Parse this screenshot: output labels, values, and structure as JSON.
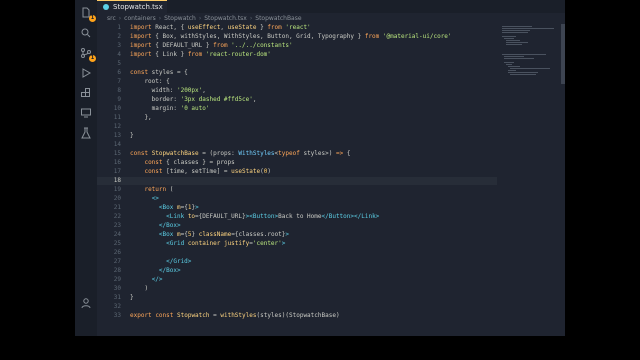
{
  "tab": {
    "label": "Stopwatch.tsx"
  },
  "breadcrumb": [
    "src",
    "containers",
    "Stopwatch",
    "Stopwatch.tsx",
    "StopwatchBase"
  ],
  "editor": {
    "current_line": 18,
    "lines": [
      {
        "n": "1",
        "segs": [
          [
            "k",
            "import"
          ],
          [
            "p",
            " React, { "
          ],
          [
            "f",
            "useEffect"
          ],
          [
            "p",
            ", "
          ],
          [
            "f",
            "useState"
          ],
          [
            "p",
            " } "
          ],
          [
            "k",
            "from"
          ],
          [
            "s",
            " 'react'"
          ]
        ]
      },
      {
        "n": "2",
        "segs": [
          [
            "k",
            "import"
          ],
          [
            "p",
            " { Box, withStyles, WithStyles, Button, Grid, Typography } "
          ],
          [
            "k",
            "from"
          ],
          [
            "s",
            " '@material-ui/core'"
          ]
        ]
      },
      {
        "n": "3",
        "segs": [
          [
            "k",
            "import"
          ],
          [
            "p",
            " { DEFAULT_URL } "
          ],
          [
            "k",
            "from"
          ],
          [
            "s",
            " '../../constants'"
          ]
        ]
      },
      {
        "n": "4",
        "segs": [
          [
            "k",
            "import"
          ],
          [
            "p",
            " { Link } "
          ],
          [
            "k",
            "from"
          ],
          [
            "s",
            " 'react-router-dom'"
          ]
        ]
      },
      {
        "n": "5",
        "segs": []
      },
      {
        "n": "6",
        "segs": [
          [
            "k",
            "const"
          ],
          [
            "p",
            " styles = {"
          ]
        ]
      },
      {
        "n": "7",
        "segs": [
          [
            "p",
            "    root: {"
          ]
        ]
      },
      {
        "n": "8",
        "segs": [
          [
            "p",
            "      width: "
          ],
          [
            "s",
            "'200px'"
          ],
          [
            "p",
            ","
          ]
        ]
      },
      {
        "n": "9",
        "segs": [
          [
            "p",
            "      border: "
          ],
          [
            "s",
            "'3px dashed #ffd5ce'"
          ],
          [
            "p",
            ","
          ]
        ]
      },
      {
        "n": "10",
        "segs": [
          [
            "p",
            "      margin: "
          ],
          [
            "s",
            "'0 auto'"
          ]
        ]
      },
      {
        "n": "11",
        "segs": [
          [
            "p",
            "    },"
          ]
        ]
      },
      {
        "n": "12",
        "segs": []
      },
      {
        "n": "13",
        "segs": [
          [
            "p",
            "}"
          ]
        ]
      },
      {
        "n": "14",
        "segs": []
      },
      {
        "n": "15",
        "segs": [
          [
            "k",
            "const"
          ],
          [
            "p",
            " "
          ],
          [
            "f",
            "StopwatchBase"
          ],
          [
            "p",
            " = (props: "
          ],
          [
            "t",
            "WithStyles"
          ],
          [
            "p",
            "<"
          ],
          [
            "k",
            "typeof"
          ],
          [
            "p",
            " styles>) "
          ],
          [
            "k",
            "=>"
          ],
          [
            "p",
            " {"
          ]
        ]
      },
      {
        "n": "16",
        "segs": [
          [
            "p",
            "    "
          ],
          [
            "k",
            "const"
          ],
          [
            "p",
            " { classes } = props"
          ]
        ]
      },
      {
        "n": "17",
        "segs": [
          [
            "p",
            "    "
          ],
          [
            "k",
            "const"
          ],
          [
            "p",
            " [time, setTime] = "
          ],
          [
            "f",
            "useState"
          ],
          [
            "p",
            "("
          ],
          [
            "n",
            "0"
          ],
          [
            "p",
            ")"
          ]
        ]
      },
      {
        "n": "18",
        "segs": []
      },
      {
        "n": "19",
        "segs": [
          [
            "p",
            "    "
          ],
          [
            "k",
            "return"
          ],
          [
            "p",
            " ("
          ]
        ]
      },
      {
        "n": "20",
        "segs": [
          [
            "p",
            "      "
          ],
          [
            "c",
            "<>"
          ]
        ]
      },
      {
        "n": "21",
        "segs": [
          [
            "p",
            "        "
          ],
          [
            "c",
            "<Box"
          ],
          [
            "p",
            " "
          ],
          [
            "f",
            "m"
          ],
          [
            "p",
            "={"
          ],
          [
            "n",
            "1"
          ],
          [
            "p",
            "}"
          ],
          [
            "c",
            ">"
          ]
        ]
      },
      {
        "n": "22",
        "segs": [
          [
            "p",
            "          "
          ],
          [
            "c",
            "<Link"
          ],
          [
            "p",
            " "
          ],
          [
            "f",
            "to"
          ],
          [
            "p",
            "={DEFAULT_URL}"
          ],
          [
            "c",
            "><Button>"
          ],
          [
            "p",
            "Back to Home"
          ],
          [
            "c",
            "</Button></Link>"
          ]
        ]
      },
      {
        "n": "23",
        "segs": [
          [
            "p",
            "        "
          ],
          [
            "c",
            "</Box>"
          ]
        ]
      },
      {
        "n": "24",
        "segs": [
          [
            "p",
            "        "
          ],
          [
            "c",
            "<Box"
          ],
          [
            "p",
            " "
          ],
          [
            "f",
            "m"
          ],
          [
            "p",
            "={"
          ],
          [
            "n",
            "5"
          ],
          [
            "p",
            "} "
          ],
          [
            "f",
            "className"
          ],
          [
            "p",
            "={classes.root}"
          ],
          [
            "c",
            ">"
          ]
        ]
      },
      {
        "n": "25",
        "segs": [
          [
            "p",
            "          "
          ],
          [
            "c",
            "<Grid"
          ],
          [
            "p",
            " "
          ],
          [
            "f",
            "container"
          ],
          [
            "p",
            " "
          ],
          [
            "f",
            "justify"
          ],
          [
            "p",
            "="
          ],
          [
            "s",
            "'center'"
          ],
          [
            "c",
            ">"
          ]
        ]
      },
      {
        "n": "26",
        "segs": []
      },
      {
        "n": "27",
        "segs": [
          [
            "p",
            "          "
          ],
          [
            "c",
            "</Grid>"
          ]
        ]
      },
      {
        "n": "28",
        "segs": [
          [
            "p",
            "        "
          ],
          [
            "c",
            "</Box>"
          ]
        ]
      },
      {
        "n": "29",
        "segs": [
          [
            "p",
            "      "
          ],
          [
            "c",
            "</>"
          ]
        ]
      },
      {
        "n": "30",
        "segs": [
          [
            "p",
            "    )"
          ]
        ]
      },
      {
        "n": "31",
        "segs": [
          [
            "p",
            "}"
          ]
        ]
      },
      {
        "n": "32",
        "segs": []
      },
      {
        "n": "33",
        "segs": [
          [
            "k",
            "export"
          ],
          [
            "p",
            " "
          ],
          [
            "k",
            "const"
          ],
          [
            "p",
            " "
          ],
          [
            "f",
            "Stopwatch"
          ],
          [
            "p",
            " = "
          ],
          [
            "f",
            "withStyles"
          ],
          [
            "p",
            "(styles)(StopwatchBase)"
          ]
        ]
      }
    ]
  },
  "activity_icons": [
    "files-icon",
    "search-icon",
    "source-control-icon",
    "run-debug-icon",
    "extensions-icon",
    "remote-explorer-icon",
    "testing-icon",
    "accounts-icon"
  ],
  "badges": {
    "files-icon": "1",
    "source-control-icon": "1"
  }
}
